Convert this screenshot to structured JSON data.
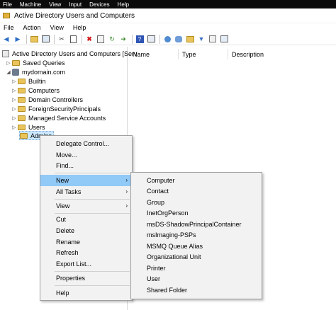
{
  "vm_menu": [
    "File",
    "Machine",
    "View",
    "Input",
    "Devices",
    "Help"
  ],
  "window_title": "Active Directory Users and Computers",
  "app_menu": [
    "File",
    "Action",
    "View",
    "Help"
  ],
  "tree": {
    "root": "Active Directory Users and Computers [Serv",
    "saved_queries": "Saved Queries",
    "domain": "mydomain.com",
    "children": [
      "Builtin",
      "Computers",
      "Domain Controllers",
      "ForeignSecurityPrincipals",
      "Managed Service Accounts",
      "Users",
      "Admins"
    ]
  },
  "list_columns": [
    "Name",
    "Type",
    "Description"
  ],
  "context_menu": {
    "items": [
      "Delegate Control...",
      "Move...",
      "Find...",
      "New",
      "All Tasks",
      "View",
      "Cut",
      "Delete",
      "Rename",
      "Refresh",
      "Export List...",
      "Properties",
      "Help"
    ],
    "submenu_arrow": "›"
  },
  "new_submenu": [
    "Computer",
    "Contact",
    "Group",
    "InetOrgPerson",
    "msDS-ShadowPrincipalContainer",
    "msImaging-PSPs",
    "MSMQ Queue Alias",
    "Organizational Unit",
    "Printer",
    "User",
    "Shared Folder"
  ],
  "colors": {
    "highlight": "#91c9f7",
    "selection": "#cce8ff",
    "folder": "#e8c45a"
  }
}
